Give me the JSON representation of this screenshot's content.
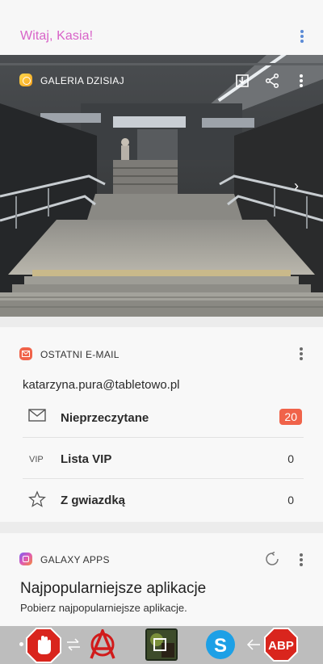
{
  "header": {
    "greeting": "Witaj, Kasia!",
    "menu_icon": "more-vert-icon"
  },
  "gallery": {
    "title": "GALERIA DZISIAJ",
    "icons": [
      "gallery-icon",
      "save-icon",
      "share-icon",
      "more-vert-icon",
      "chevron-right-icon"
    ]
  },
  "email": {
    "title": "OSTATNI E-MAIL",
    "account": "katarzyna.pura@tabletowo.pl",
    "rows": [
      {
        "icon": "envelope-icon",
        "label": "Nieprzeczytane",
        "count": "20",
        "highlight": true
      },
      {
        "icon": "vip-text",
        "icon_text": "VIP",
        "label": "Lista VIP",
        "count": "0"
      },
      {
        "icon": "star-outline-icon",
        "label": "Z gwiazdką",
        "count": "0"
      }
    ],
    "accent": "#f0634a"
  },
  "apps": {
    "title": "GALAXY APPS",
    "heading": "Najpopularniejsze aplikacje",
    "subtitle": "Pobierz najpopularniejsze aplikacje."
  },
  "taskbar": {
    "items": [
      "dot-indicator",
      "adblock-hand-icon",
      "swap-icon",
      "anarchy-icon",
      "photo-app-icon",
      "skype-icon",
      "back-arrow-icon",
      "abp-icon"
    ],
    "abp_text": "ABP",
    "skype_text": "S"
  },
  "colors": {
    "greeting": "#d863c8",
    "menu": "#5b8bd6"
  }
}
